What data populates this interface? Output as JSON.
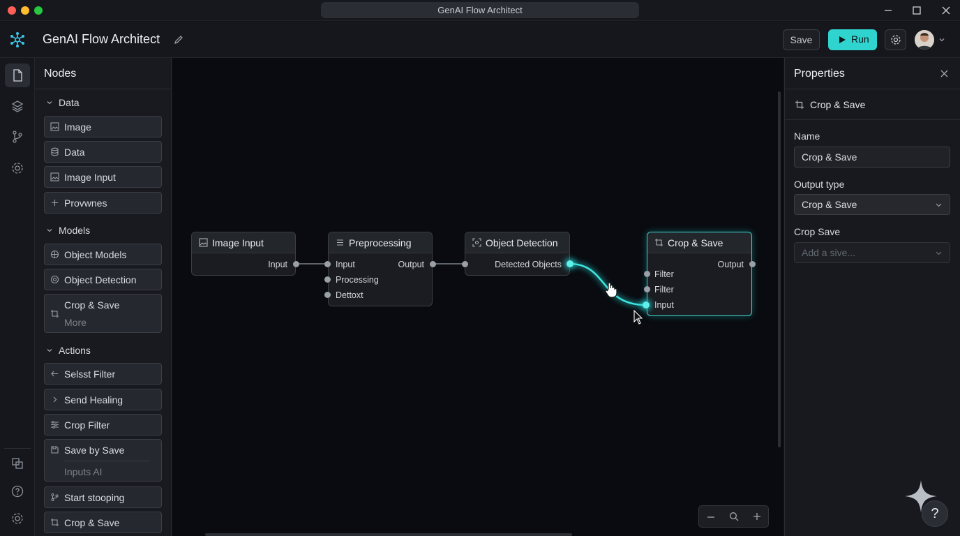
{
  "window": {
    "title": "GenAI Flow Architect"
  },
  "header": {
    "app_title": "GenAI Flow Architect",
    "save_label": "Save",
    "run_label": "Run"
  },
  "nodes_panel": {
    "title": "Nodes",
    "sections": {
      "data": {
        "label": "Data",
        "items": [
          "Image",
          "Data",
          "Image Input",
          "Provwnes"
        ]
      },
      "models": {
        "label": "Models",
        "items": [
          "Object Models",
          "Object Detection",
          "Crop & Save"
        ],
        "more_label": "More"
      },
      "actions": {
        "label": "Actions",
        "items": [
          "Selsst Filter",
          "Send Healing",
          "Crop Filter",
          "Save by Save",
          "Start stooping",
          "Crop & Save"
        ],
        "sub_label": "Inputs AI"
      }
    }
  },
  "canvas": {
    "nodes": {
      "image_input": {
        "title": "Image Input",
        "out": "Input"
      },
      "preprocessing": {
        "title": "Preprocessing",
        "in1": "Input",
        "in2": "Processing",
        "in3": "Dettoxt",
        "out": "Output"
      },
      "object_detection": {
        "title": "Object Detection",
        "out": "Detected Objects"
      },
      "crop_save": {
        "title": "Crop & Save",
        "in1": "Filter",
        "in2": "Filter",
        "in3": "Input",
        "out": "Output"
      }
    },
    "accent_color": "#27d3d1"
  },
  "properties": {
    "title": "Properties",
    "node_name": "Crop & Save",
    "name_label": "Name",
    "name_value": "Crop & Save",
    "output_type_label": "Output type",
    "output_type_value": "Crop & Save",
    "crop_save_label": "Crop Save",
    "crop_save_placeholder": "Add a sive..."
  },
  "colors": {
    "run_button": "#2fd4cf",
    "edge_active": "#27d3d1"
  }
}
